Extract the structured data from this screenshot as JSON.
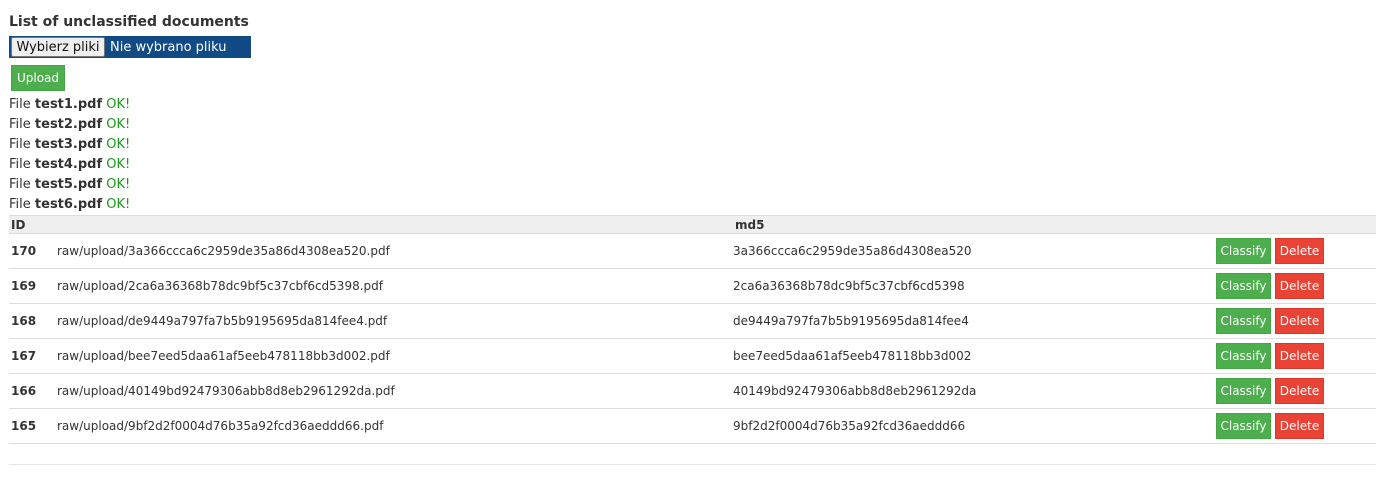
{
  "page": {
    "heading": "List of unclassified documents"
  },
  "file_picker": {
    "button_label": "Wybierz pliki",
    "status_text": "Nie wybrano pliku"
  },
  "upload": {
    "label": "Upload"
  },
  "status_messages": [
    {
      "prefix": "File",
      "filename": "test1.pdf",
      "status": "OK!"
    },
    {
      "prefix": "File",
      "filename": "test2.pdf",
      "status": "OK!"
    },
    {
      "prefix": "File",
      "filename": "test3.pdf",
      "status": "OK!"
    },
    {
      "prefix": "File",
      "filename": "test4.pdf",
      "status": "OK!"
    },
    {
      "prefix": "File",
      "filename": "test5.pdf",
      "status": "OK!"
    },
    {
      "prefix": "File",
      "filename": "test6.pdf",
      "status": "OK!"
    }
  ],
  "table": {
    "headers": {
      "id": "ID",
      "path": "",
      "md5": "md5",
      "actions": ""
    },
    "classify_label": "Classify",
    "delete_label": "Delete",
    "rows": [
      {
        "id": "170",
        "path": "raw/upload/3a366ccca6c2959de35a86d4308ea520.pdf",
        "md5": "3a366ccca6c2959de35a86d4308ea520"
      },
      {
        "id": "169",
        "path": "raw/upload/2ca6a36368b78dc9bf5c37cbf6cd5398.pdf",
        "md5": "2ca6a36368b78dc9bf5c37cbf6cd5398"
      },
      {
        "id": "168",
        "path": "raw/upload/de9449a797fa7b5b9195695da814fee4.pdf",
        "md5": "de9449a797fa7b5b9195695da814fee4"
      },
      {
        "id": "167",
        "path": "raw/upload/bee7eed5daa61af5eeb478118bb3d002.pdf",
        "md5": "bee7eed5daa61af5eeb478118bb3d002"
      },
      {
        "id": "166",
        "path": "raw/upload/40149bd92479306abb8d8eb2961292da.pdf",
        "md5": "40149bd92479306abb8d8eb2961292da"
      },
      {
        "id": "165",
        "path": "raw/upload/9bf2d2f0004d76b35a92fcd36aeddd66.pdf",
        "md5": "9bf2d2f0004d76b35a92fcd36aeddd66"
      }
    ]
  },
  "colors": {
    "success": "#4cae4c",
    "danger": "#ea4336",
    "file_input_bg": "#124a86",
    "ok_text": "#1a9a1a",
    "table_header_bg": "#efefef"
  }
}
